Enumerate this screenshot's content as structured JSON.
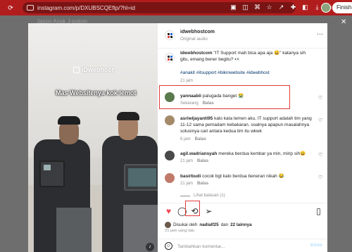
{
  "browser": {
    "url": "instagram.com/p/DXUBSCQEftp/?hl=id",
    "finish_label": "Finish"
  },
  "backdrop": {
    "behind_text": "Jason Anak J-polom"
  },
  "photo": {
    "brand": "iDwebhost",
    "caption": "Mas Websitenya kok lemot"
  },
  "post": {
    "username": "idwebhostcom",
    "audio": "Original audio",
    "caption_user": "idwebhostcom",
    "caption_text": "\"IT Support mah bisa apa aja 😀\" katanya sih gitu, emang bener begitu? 👀",
    "hashtags": "#anakit #itsupport #bikinwebsite #idwebhost",
    "caption_time": "21 jam"
  },
  "comments": [
    {
      "user": "yannaabii",
      "text": "palugada banget 😭",
      "time": "Sekarang",
      "reply": "Balas",
      "avatar_color": "#5b7a4d"
    },
    {
      "user": "asriwijayanti95",
      "text": "kalo kata temen aku, IT support adalah tim yang 11-12 sama pemadam kebakaran. soalnya apapun masalahnya solusinya cari antara kedua tim itu wkwk",
      "time": "6 jam",
      "reply": "Balas",
      "avatar_color": "#a58a6a"
    },
    {
      "user": "agil.wadriansyah",
      "text": "mereka berdua kembar ya min, mirip sih😀",
      "time": "21 jam",
      "reply": "Balas",
      "avatar_color": "#4a4a4a"
    },
    {
      "user": "basirbudi",
      "text": "cocok bgt kalo berdua beneran nikah 😂",
      "time": "21 jam",
      "reply": "Balas",
      "avatar_color": "#c07a6a"
    }
  ],
  "view_replies": "Lihat balasan (1)",
  "likes": {
    "prefix": "Disukai oleh",
    "user": "nadialf25",
    "joiner": "dan",
    "others": "22 lainnya"
  },
  "post_time": "21 jam yang lalu",
  "add_comment": {
    "placeholder": "Tambahkan komentar...",
    "post_label": "Kirim"
  }
}
